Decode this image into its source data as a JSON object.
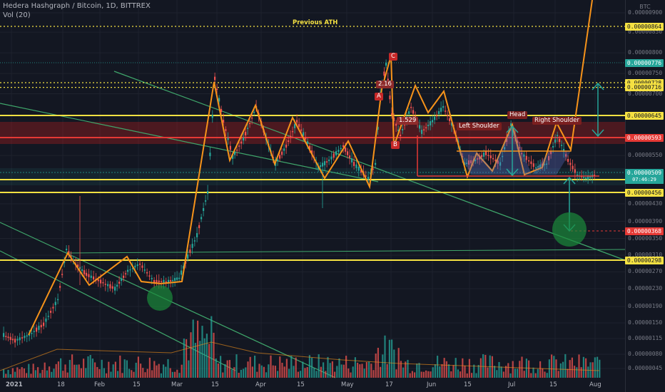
{
  "header": {
    "title": "Hedera Hashgraph / Bitcoin, 1D, BITTREX",
    "volume": "Vol (20)",
    "countdown": "07:46:29"
  },
  "axis": {
    "currency": "BTC",
    "price_labels": [
      "0.00000900",
      "0.00000850",
      "0.00000800",
      "0.00000750",
      "0.00000700",
      "0.00000550",
      "0.00000430",
      "0.00000390",
      "0.00000350",
      "0.00000310",
      "0.00000270",
      "0.00000230",
      "0.00000190",
      "0.00000150",
      "0.00000115",
      "0.00000080",
      "0.00000045"
    ],
    "x_labels": [
      "2021",
      "18",
      "Feb",
      "15",
      "Mar",
      "15",
      "Apr",
      "15",
      "May",
      "17",
      "Jun",
      "15",
      "Jul",
      "15",
      "Aug"
    ]
  },
  "tags": [
    {
      "value": "0.00000864",
      "bg": "#f5e142",
      "fg": "#131722"
    },
    {
      "value": "0.00000776",
      "bg": "#26a69a",
      "fg": "#ffffff"
    },
    {
      "value": "0.00000728",
      "bg": "#f5e142",
      "fg": "#131722"
    },
    {
      "value": "0.00000716",
      "bg": "#f5e142",
      "fg": "#131722"
    },
    {
      "value": "0.00000645",
      "bg": "#f5e142",
      "fg": "#131722"
    },
    {
      "value": "0.00000593",
      "bg": "#e53935",
      "fg": "#ffffff"
    },
    {
      "value": "0.00000509",
      "bg": "#26a69a",
      "fg": "#ffffff"
    },
    {
      "value": "0.00000490",
      "bg": "#f5e142",
      "fg": "#131722"
    },
    {
      "value": "0.00000456",
      "bg": "#f5e142",
      "fg": "#131722"
    },
    {
      "value": "0.00000368",
      "bg": "#e53935",
      "fg": "#ffffff"
    },
    {
      "value": "0.00000298",
      "bg": "#f5e142",
      "fg": "#131722"
    }
  ],
  "annotations": {
    "previous_ath": "Previous ATH",
    "left_shoulder": "Left Shoulder",
    "head": "Head",
    "right_shoulder": "Right Shoulder",
    "c": "C",
    "a": "A",
    "b": "B",
    "fib1": "2.16",
    "fib2": "1.529"
  },
  "colors": {
    "background": "#131722",
    "up": "#26a69a",
    "down": "#ef5350",
    "support": "#f5e142",
    "pattern": "#f7931a",
    "trendline": "#3fa66b",
    "arrow": "#26a69a"
  },
  "chart_data": {
    "type": "candlestick",
    "title": "Hedera Hashgraph / Bitcoin, 1D, BITTREX",
    "xlabel": "",
    "ylabel": "",
    "unit": "BTC",
    "scale": "log",
    "x": [
      "2021-01-01",
      "2021-01-18",
      "2021-02-01",
      "2021-02-15",
      "2021-03-01",
      "2021-03-15",
      "2021-04-01",
      "2021-04-15",
      "2021-05-01",
      "2021-05-17",
      "2021-06-01",
      "2021-06-15",
      "2021-07-01",
      "2021-07-15",
      "2021-08-01"
    ],
    "ylim": [
      3e-07,
      9.4e-06
    ],
    "close": [
      1.1e-06,
      3e-06,
      2.6e-06,
      2.9e-06,
      2.6e-06,
      7e-06,
      5.6e-06,
      6e-06,
      4.8e-06,
      6.3e-06,
      6.4e-06,
      5.2e-06,
      5.9e-06,
      5.2e-06,
      5.09e-06
    ],
    "volume": [
      6,
      10,
      7,
      8,
      12,
      25,
      14,
      13,
      9,
      16,
      9,
      8,
      7,
      9,
      6
    ],
    "horizontal_levels": [
      8.64e-06,
      7.28e-06,
      7.16e-06,
      6.45e-06,
      5.93e-06,
      4.9e-06,
      4.56e-06,
      3.68e-06,
      2.98e-06
    ],
    "last_price": 5.09e-06,
    "grid": true,
    "legend": "none"
  }
}
